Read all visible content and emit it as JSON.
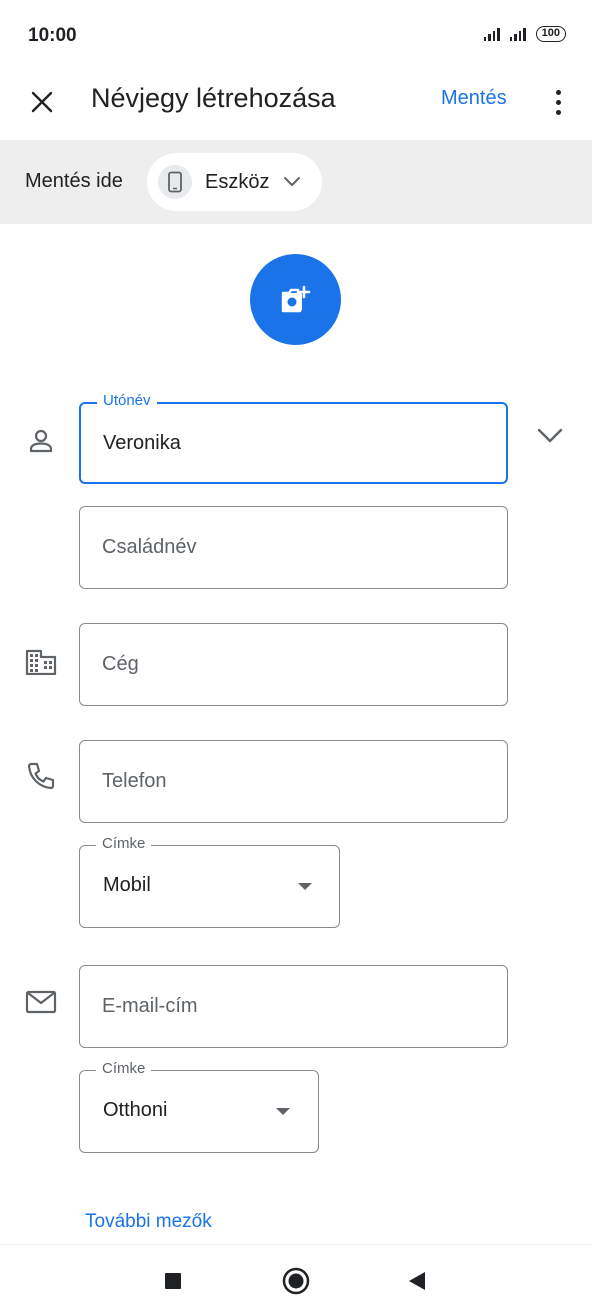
{
  "status_bar": {
    "time": "10:00",
    "battery": "100"
  },
  "app_bar": {
    "close_icon": "close-icon",
    "title": "Névjegy létrehozása",
    "save_label": "Mentés",
    "more_icon": "more-vert-icon"
  },
  "save_to": {
    "label": "Mentés ide",
    "account": "Eszköz",
    "account_icon": "phone-icon"
  },
  "photo": {
    "icon": "add-photo-icon",
    "color": "#1a73e8"
  },
  "form": {
    "first_name": {
      "label": "Utónév",
      "value": "Veronika"
    },
    "last_name": {
      "placeholder": "Családnév"
    },
    "company": {
      "placeholder": "Cég"
    },
    "phone": {
      "placeholder": "Telefon"
    },
    "phone_label": {
      "label": "Címke",
      "value": "Mobil"
    },
    "email": {
      "placeholder": "E-mail-cím"
    },
    "email_label": {
      "label": "Címke",
      "value": "Otthoni"
    }
  },
  "more_fields_label": "További mezők",
  "colors": {
    "accent": "#1a73e8",
    "save_to_bg": "#eeeeee"
  }
}
